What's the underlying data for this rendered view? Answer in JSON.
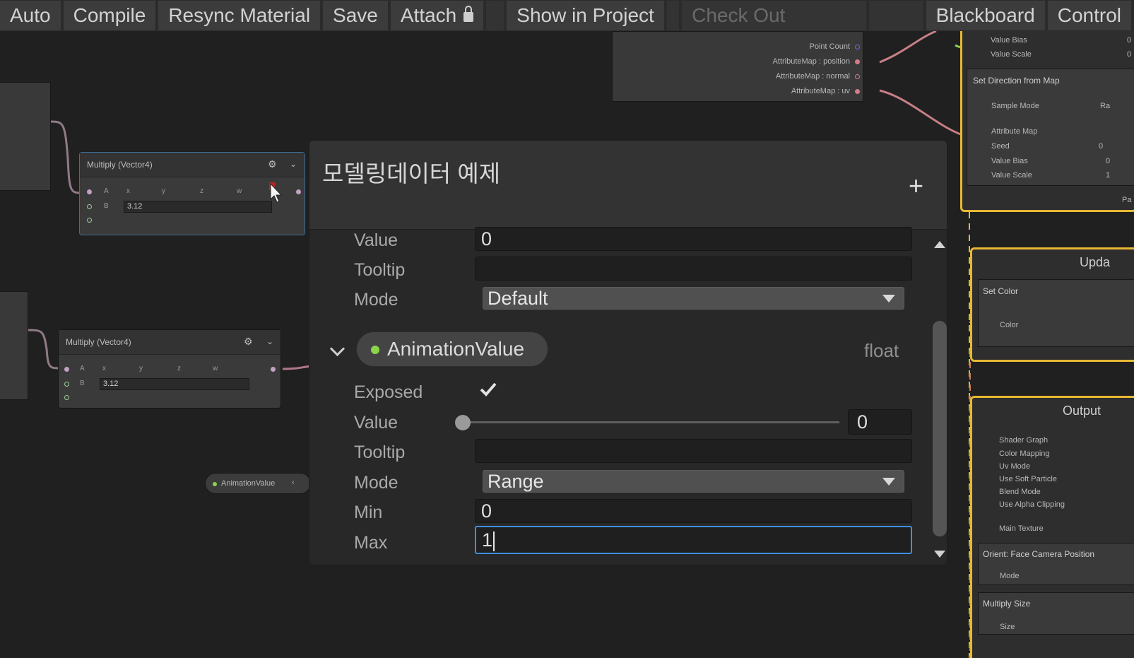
{
  "toolbar": {
    "auto": "Auto",
    "compile": "Compile",
    "resync": "Resync Material",
    "save": "Save",
    "attach": "Attach",
    "show_in_project": "Show in Project",
    "check_out": "Check Out",
    "blackboard": "Blackboard",
    "control": "Control"
  },
  "graph": {
    "node_top": {
      "title": "Multiply (Vector4)",
      "port_a": "A",
      "port_b": "B",
      "b_value": "3.12",
      "x": "x",
      "y": "y",
      "z": "z",
      "w": "w"
    },
    "node_bottom": {
      "title": "Multiply (Vector4)",
      "port_a": "A",
      "port_b": "B",
      "b_value": "3.12",
      "x": "x",
      "y": "y",
      "z": "z",
      "w": "w"
    },
    "param_chip": "AnimationValue",
    "point_node": {
      "point_count": "Point Count",
      "attr_position": "AttributeMap : position",
      "attr_normal": "AttributeMap : normal",
      "attr_uv": "AttributeMap : uv"
    },
    "init_context": {
      "value_bias": "Value Bias",
      "value_scale": "Value Scale",
      "set_direction": "Set Direction from Map",
      "sample_mode": "Sample Mode",
      "sample_mode_value": "Ra",
      "attribute_map": "Attribute Map",
      "seed": "Seed",
      "seed_value": "0",
      "value_bias2": "Value Bias",
      "value_scale2": "Value Scale",
      "x_label": "x",
      "bias_val": "0",
      "scale_val": "1",
      "top_bias_val": "0",
      "top_scale_val": "0",
      "pa": "Pa"
    },
    "update_context": {
      "title": "Upda",
      "set_color": "Set Color",
      "color": "Color"
    },
    "output_context": {
      "title": "Output",
      "shader_graph": "Shader Graph",
      "color_mapping": "Color Mapping",
      "uv_mode": "Uv Mode",
      "use_soft_particle": "Use Soft Particle",
      "blend_mode": "Blend Mode",
      "use_alpha_clipping": "Use Alpha Clipping",
      "main_texture": "Main Texture",
      "orient": "Orient: Face Camera Position",
      "mode": "Mode",
      "multiply_size": "Multiply Size",
      "size": "Size"
    }
  },
  "blackboard": {
    "title": "모델링데이터 예제",
    "add": "+",
    "prev_property": {
      "value_label": "Value",
      "value": "0",
      "tooltip_label": "Tooltip",
      "tooltip": "",
      "mode_label": "Mode",
      "mode": "Default"
    },
    "property": {
      "name": "AnimationValue",
      "type": "float",
      "exposed_label": "Exposed",
      "exposed": true,
      "value_label": "Value",
      "value": "0",
      "slider_fraction": 0.0,
      "tooltip_label": "Tooltip",
      "tooltip": "",
      "mode_label": "Mode",
      "mode": "Range",
      "min_label": "Min",
      "min": "0",
      "max_label": "Max",
      "max": "1"
    },
    "colors": {
      "accent": "#3d8fe0",
      "float_dot": "#8bd54a",
      "context_border": "#e8b832",
      "wire": "#c77f86"
    }
  }
}
